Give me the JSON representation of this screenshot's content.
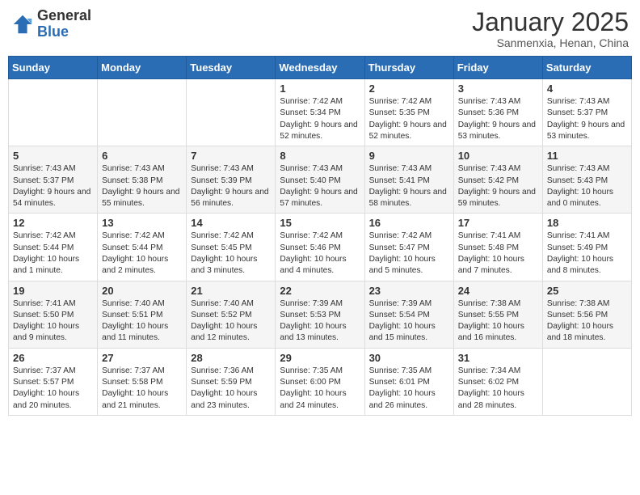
{
  "header": {
    "logo_general": "General",
    "logo_blue": "Blue",
    "month_title": "January 2025",
    "subtitle": "Sanmenxia, Henan, China"
  },
  "weekdays": [
    "Sunday",
    "Monday",
    "Tuesday",
    "Wednesday",
    "Thursday",
    "Friday",
    "Saturday"
  ],
  "weeks": [
    [
      {
        "day": "",
        "info": ""
      },
      {
        "day": "",
        "info": ""
      },
      {
        "day": "",
        "info": ""
      },
      {
        "day": "1",
        "info": "Sunrise: 7:42 AM\nSunset: 5:34 PM\nDaylight: 9 hours and 52 minutes."
      },
      {
        "day": "2",
        "info": "Sunrise: 7:42 AM\nSunset: 5:35 PM\nDaylight: 9 hours and 52 minutes."
      },
      {
        "day": "3",
        "info": "Sunrise: 7:43 AM\nSunset: 5:36 PM\nDaylight: 9 hours and 53 minutes."
      },
      {
        "day": "4",
        "info": "Sunrise: 7:43 AM\nSunset: 5:37 PM\nDaylight: 9 hours and 53 minutes."
      }
    ],
    [
      {
        "day": "5",
        "info": "Sunrise: 7:43 AM\nSunset: 5:37 PM\nDaylight: 9 hours and 54 minutes."
      },
      {
        "day": "6",
        "info": "Sunrise: 7:43 AM\nSunset: 5:38 PM\nDaylight: 9 hours and 55 minutes."
      },
      {
        "day": "7",
        "info": "Sunrise: 7:43 AM\nSunset: 5:39 PM\nDaylight: 9 hours and 56 minutes."
      },
      {
        "day": "8",
        "info": "Sunrise: 7:43 AM\nSunset: 5:40 PM\nDaylight: 9 hours and 57 minutes."
      },
      {
        "day": "9",
        "info": "Sunrise: 7:43 AM\nSunset: 5:41 PM\nDaylight: 9 hours and 58 minutes."
      },
      {
        "day": "10",
        "info": "Sunrise: 7:43 AM\nSunset: 5:42 PM\nDaylight: 9 hours and 59 minutes."
      },
      {
        "day": "11",
        "info": "Sunrise: 7:43 AM\nSunset: 5:43 PM\nDaylight: 10 hours and 0 minutes."
      }
    ],
    [
      {
        "day": "12",
        "info": "Sunrise: 7:42 AM\nSunset: 5:44 PM\nDaylight: 10 hours and 1 minute."
      },
      {
        "day": "13",
        "info": "Sunrise: 7:42 AM\nSunset: 5:44 PM\nDaylight: 10 hours and 2 minutes."
      },
      {
        "day": "14",
        "info": "Sunrise: 7:42 AM\nSunset: 5:45 PM\nDaylight: 10 hours and 3 minutes."
      },
      {
        "day": "15",
        "info": "Sunrise: 7:42 AM\nSunset: 5:46 PM\nDaylight: 10 hours and 4 minutes."
      },
      {
        "day": "16",
        "info": "Sunrise: 7:42 AM\nSunset: 5:47 PM\nDaylight: 10 hours and 5 minutes."
      },
      {
        "day": "17",
        "info": "Sunrise: 7:41 AM\nSunset: 5:48 PM\nDaylight: 10 hours and 7 minutes."
      },
      {
        "day": "18",
        "info": "Sunrise: 7:41 AM\nSunset: 5:49 PM\nDaylight: 10 hours and 8 minutes."
      }
    ],
    [
      {
        "day": "19",
        "info": "Sunrise: 7:41 AM\nSunset: 5:50 PM\nDaylight: 10 hours and 9 minutes."
      },
      {
        "day": "20",
        "info": "Sunrise: 7:40 AM\nSunset: 5:51 PM\nDaylight: 10 hours and 11 minutes."
      },
      {
        "day": "21",
        "info": "Sunrise: 7:40 AM\nSunset: 5:52 PM\nDaylight: 10 hours and 12 minutes."
      },
      {
        "day": "22",
        "info": "Sunrise: 7:39 AM\nSunset: 5:53 PM\nDaylight: 10 hours and 13 minutes."
      },
      {
        "day": "23",
        "info": "Sunrise: 7:39 AM\nSunset: 5:54 PM\nDaylight: 10 hours and 15 minutes."
      },
      {
        "day": "24",
        "info": "Sunrise: 7:38 AM\nSunset: 5:55 PM\nDaylight: 10 hours and 16 minutes."
      },
      {
        "day": "25",
        "info": "Sunrise: 7:38 AM\nSunset: 5:56 PM\nDaylight: 10 hours and 18 minutes."
      }
    ],
    [
      {
        "day": "26",
        "info": "Sunrise: 7:37 AM\nSunset: 5:57 PM\nDaylight: 10 hours and 20 minutes."
      },
      {
        "day": "27",
        "info": "Sunrise: 7:37 AM\nSunset: 5:58 PM\nDaylight: 10 hours and 21 minutes."
      },
      {
        "day": "28",
        "info": "Sunrise: 7:36 AM\nSunset: 5:59 PM\nDaylight: 10 hours and 23 minutes."
      },
      {
        "day": "29",
        "info": "Sunrise: 7:35 AM\nSunset: 6:00 PM\nDaylight: 10 hours and 24 minutes."
      },
      {
        "day": "30",
        "info": "Sunrise: 7:35 AM\nSunset: 6:01 PM\nDaylight: 10 hours and 26 minutes."
      },
      {
        "day": "31",
        "info": "Sunrise: 7:34 AM\nSunset: 6:02 PM\nDaylight: 10 hours and 28 minutes."
      },
      {
        "day": "",
        "info": ""
      }
    ]
  ]
}
